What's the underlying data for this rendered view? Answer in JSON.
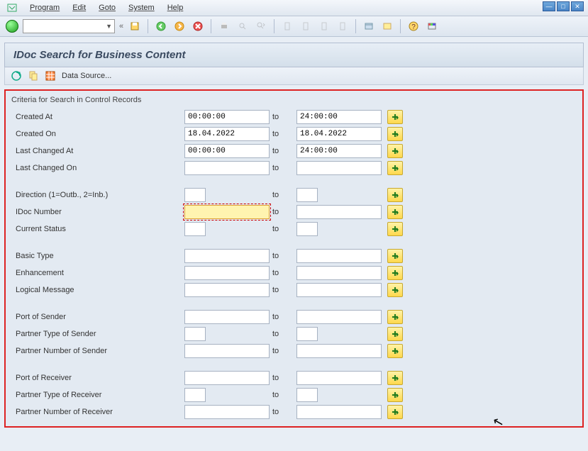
{
  "window_controls": {
    "minimize": "—",
    "maximize": "□",
    "close": "✕"
  },
  "menu": {
    "items": [
      "Program",
      "Edit",
      "Goto",
      "System",
      "Help"
    ]
  },
  "toolbar_std": {
    "back_arrows": "«"
  },
  "title": "IDoc Search for Business Content",
  "app_toolbar": {
    "datasource": "Data Source..."
  },
  "criteria": {
    "group_title": "Criteria for Search in Control Records",
    "to_label": "to",
    "rows": [
      {
        "label": "Created At",
        "from": "00:00:00",
        "to": "24:00:00",
        "fw": "full",
        "tw": "full"
      },
      {
        "label": "Created On",
        "from": "18.04.2022",
        "to": "18.04.2022",
        "fw": "full",
        "tw": "full"
      },
      {
        "label": "Last Changed At",
        "from": "00:00:00",
        "to": "24:00:00",
        "fw": "full",
        "tw": "full"
      },
      {
        "label": "Last Changed On",
        "from": "",
        "to": "",
        "fw": "full",
        "tw": "full"
      },
      {
        "spacer": true
      },
      {
        "label": "Direction (1=Outb., 2=Inb.)",
        "from": "",
        "to": "",
        "fw": "short",
        "tw": "short"
      },
      {
        "label": "IDoc Number",
        "from": "",
        "to": "",
        "fw": "full",
        "tw": "full",
        "highlight": true
      },
      {
        "label": "Current Status",
        "from": "",
        "to": "",
        "fw": "short",
        "tw": "short"
      },
      {
        "spacer": true
      },
      {
        "label": "Basic Type",
        "from": "",
        "to": "",
        "fw": "full",
        "tw": "full"
      },
      {
        "label": "Enhancement",
        "from": "",
        "to": "",
        "fw": "full",
        "tw": "full"
      },
      {
        "label": "Logical Message",
        "from": "",
        "to": "",
        "fw": "full",
        "tw": "full"
      },
      {
        "spacer": true
      },
      {
        "label": "Port of Sender",
        "from": "",
        "to": "",
        "fw": "full",
        "tw": "full"
      },
      {
        "label": "Partner Type of Sender",
        "from": "",
        "to": "",
        "fw": "short",
        "tw": "short"
      },
      {
        "label": "Partner Number of Sender",
        "from": "",
        "to": "",
        "fw": "full",
        "tw": "full"
      },
      {
        "spacer": true
      },
      {
        "label": "Port of Receiver",
        "from": "",
        "to": "",
        "fw": "full",
        "tw": "full"
      },
      {
        "label": "Partner Type of Receiver",
        "from": "",
        "to": "",
        "fw": "short",
        "tw": "short"
      },
      {
        "label": "Partner Number of Receiver",
        "from": "",
        "to": "",
        "fw": "full",
        "tw": "full"
      }
    ]
  }
}
